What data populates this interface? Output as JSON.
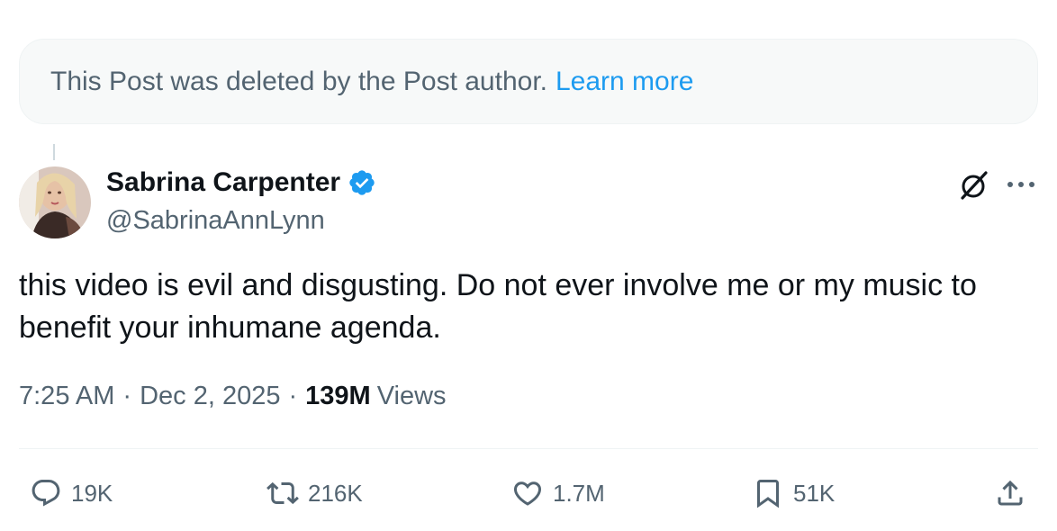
{
  "deleted_notice": {
    "text": "This Post was deleted by the Post author.",
    "link_label": "Learn more"
  },
  "author": {
    "display_name": "Sabrina Carpenter",
    "handle": "@SabrinaAnnLynn",
    "verified": true
  },
  "post": {
    "text": "this video is evil and disgusting. Do not ever involve me or my music to benefit your inhumane agenda.",
    "time": "7:25 AM",
    "date": "Dec 2, 2025",
    "separator": "·",
    "views_count": "139M",
    "views_label": "Views"
  },
  "actions": {
    "replies": "19K",
    "reposts": "216K",
    "likes": "1.7M",
    "bookmarks": "51K"
  },
  "icons": {
    "grok": "grok-icon",
    "more": "more-icon",
    "reply": "reply-icon",
    "repost": "repost-icon",
    "like": "heart-icon",
    "bookmark": "bookmark-icon",
    "share": "share-icon",
    "verified": "verified-badge-icon"
  },
  "colors": {
    "accent": "#1d9bf0",
    "text_primary": "#0f1419",
    "text_secondary": "#536471",
    "notice_bg": "#f7f9f9"
  }
}
